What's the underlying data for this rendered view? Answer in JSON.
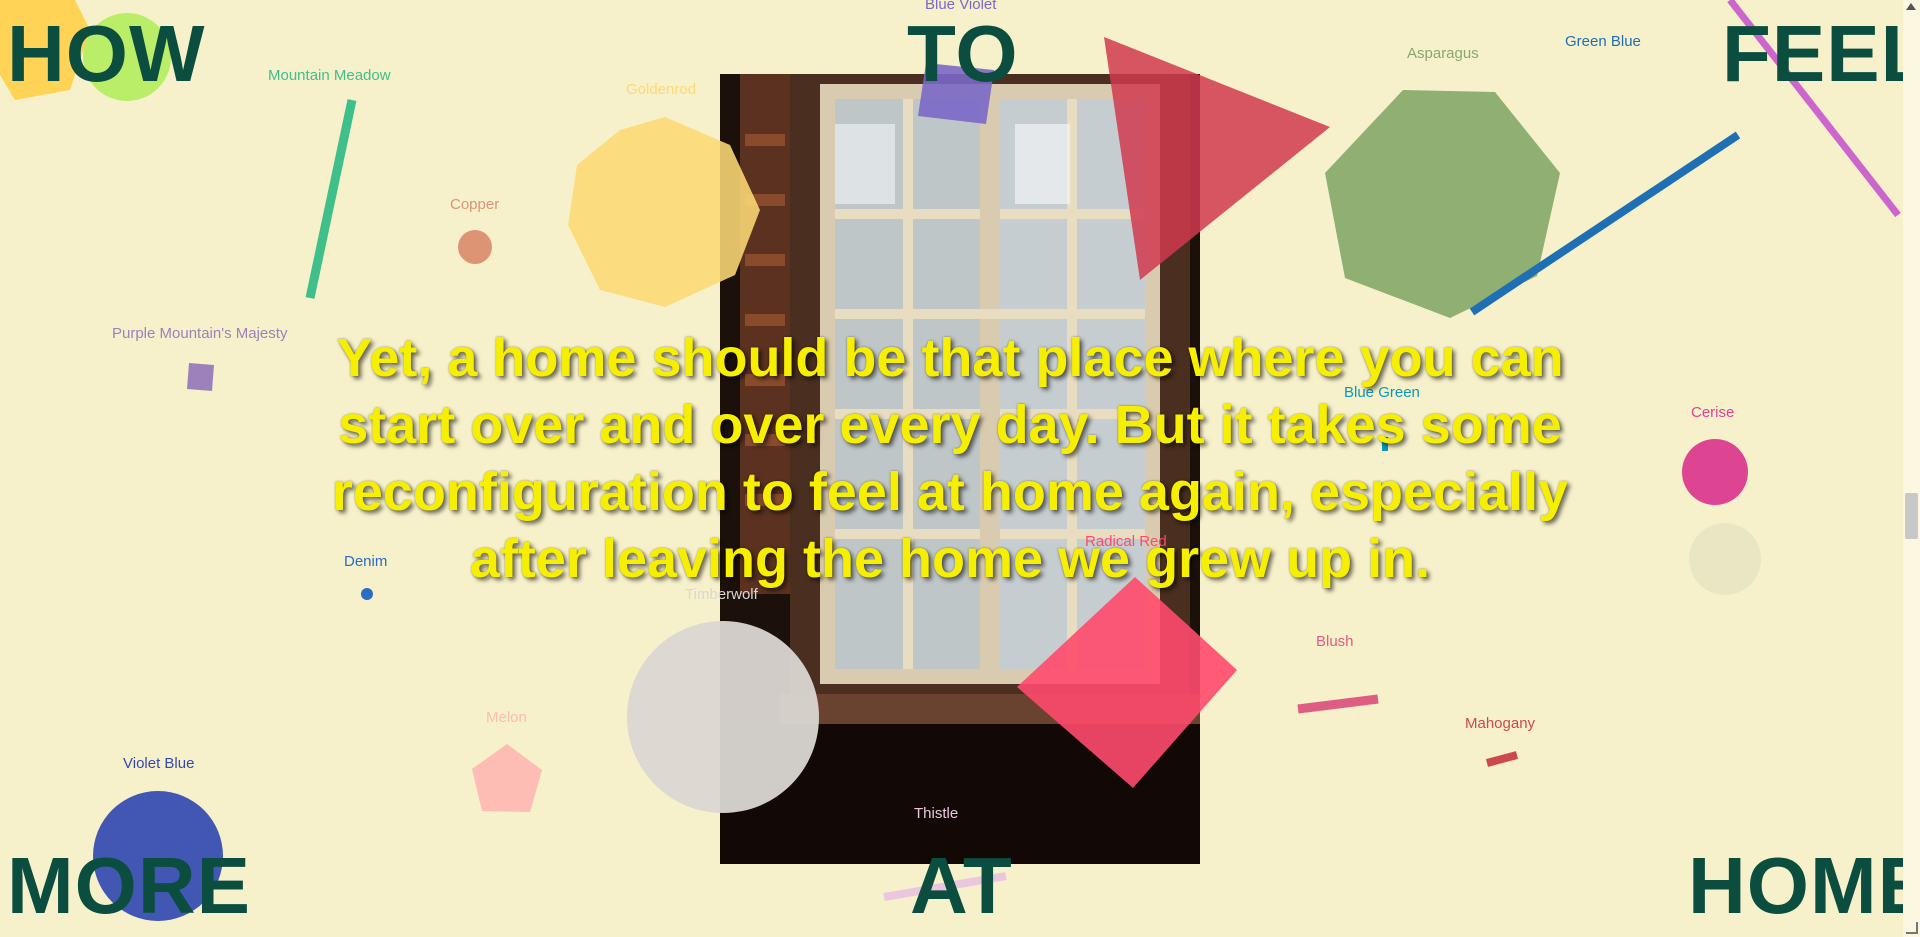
{
  "headline": {
    "top_left": "HOW",
    "top_center": "TO",
    "top_right": "FEEL",
    "bottom_left": "MORE",
    "bottom_center": "AT",
    "bottom_right": "HOME"
  },
  "quote": "Yet, a home should be that place where you can start over and over every day. But it takes some reconfiguration to feel at home again, especially after leaving the home we grew up in.",
  "color_labels": {
    "blue_violet": "Blue Violet",
    "mountain_meadow": "Mountain Meadow",
    "goldenrod": "Goldenrod",
    "asparagus": "Asparagus",
    "green_blue": "Green Blue",
    "copper": "Copper",
    "purple_mountains_majesty": "Purple Mountain's Majesty",
    "blue_green": "Blue Green",
    "cerise": "Cerise",
    "denim": "Denim",
    "timberwolf": "Timberwolf",
    "radical_red": "Radical Red",
    "blush": "Blush",
    "mahogany": "Mahogany",
    "melon": "Melon",
    "violet_blue": "Violet Blue",
    "thistle": "Thistle"
  },
  "colors": {
    "background": "#f7f1cb",
    "heading": "#0b4e3f",
    "quote": "#f6f000",
    "blue_violet": "#7a68c8",
    "mountain_meadow": "#3fbf8a",
    "goldenrod": "#fcd975",
    "asparagus": "#87a96b",
    "green_blue": "#1f6fb5",
    "copper": "#dd9475",
    "purple_mountains_majesty": "#9d81ba",
    "blue_green": "#0d98ba",
    "cerise": "#dd4492",
    "denim": "#2b6cc4",
    "timberwolf": "#dbd7d2",
    "radical_red": "#ff4a6d",
    "blush": "#de5d83",
    "mahogany": "#cd4a4c",
    "melon": "#fdbcb4",
    "violet_blue": "#324ab2",
    "thistle": "#ebc7df",
    "brink_pink": "#d35470",
    "orchid": "#cc66cc",
    "sunglow": "#ffcf48",
    "inchworm": "#b2ec5d"
  },
  "icons": {
    "scroll_up": "triangle-up-icon",
    "resize_grip": "resize-grip-icon"
  }
}
